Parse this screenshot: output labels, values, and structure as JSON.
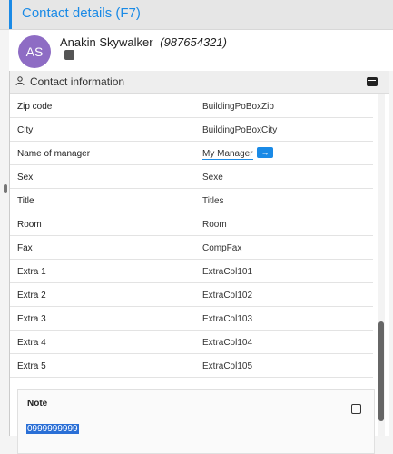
{
  "header": {
    "title": "Contact details (F7)"
  },
  "contact": {
    "initials": "AS",
    "name": "Anakin Skywalker",
    "phone": "(987654321)",
    "avatar_color": "#8e6cc4"
  },
  "panel": {
    "title": "Contact information",
    "rows": [
      {
        "label": "Zip code",
        "value": "BuildingPoBoxZip"
      },
      {
        "label": "City",
        "value": "BuildingPoBoxCity"
      },
      {
        "label": "Name of manager",
        "value": "My Manager",
        "button_icon": "arrow-right-icon"
      },
      {
        "label": "Sex",
        "value": "Sexe"
      },
      {
        "label": "Title",
        "value": "Titles"
      },
      {
        "label": "Room",
        "value": "Room"
      },
      {
        "label": "Fax",
        "value": "CompFax"
      },
      {
        "label": "Extra 1",
        "value": "ExtraCol101"
      },
      {
        "label": "Extra 2",
        "value": "ExtraCol102"
      },
      {
        "label": "Extra 3",
        "value": "ExtraCol103"
      },
      {
        "label": "Extra 4",
        "value": "ExtraCol104"
      },
      {
        "label": "Extra 5",
        "value": "ExtraCol105"
      }
    ]
  },
  "note": {
    "label": "Note",
    "value": "0999999999"
  },
  "colors": {
    "accent": "#1a8ae6",
    "selection": "#2a6fd6"
  }
}
